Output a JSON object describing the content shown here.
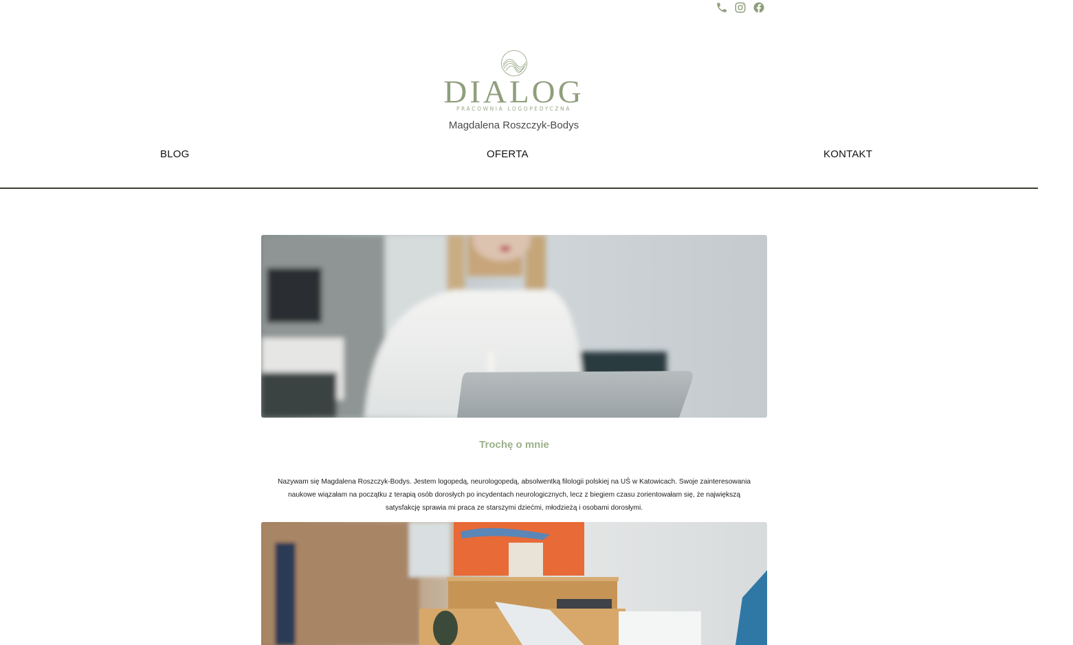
{
  "social": {
    "icons": [
      "phone-icon",
      "instagram-icon",
      "facebook-icon"
    ],
    "color": "#8f9e7c"
  },
  "brand": {
    "logo_word": "DIALOG",
    "logo_tagline": "PRACOWNIA LOGOPEDYCZNA",
    "owner_name": "Magdalena Roszczyk-Bodys",
    "accent_color": "#8f9e7c"
  },
  "nav": {
    "items": [
      {
        "label": "BLOG"
      },
      {
        "label": "OFERTA"
      },
      {
        "label": "KONTAKT"
      }
    ]
  },
  "about": {
    "title": "Trochę o mnie",
    "text": "Nazywam się Magdalena Roszczyk-Bodys. Jestem logopedą, neurologopedą, absolwentką filologii polskiej na UŚ w Katowicach. Swoje zainteresowania naukowe wiązałam na początku z terapią osób dorosłych po incydentach neurologicznych, lecz z biegiem czasu zorientowałam się, że największą satysfakcję sprawia mi praca ze starszymi dziećmi, młodzieżą i osobami dorosłymi."
  },
  "images": {
    "first": "woman-with-laptop-photo",
    "second": "office-desk-photo"
  }
}
